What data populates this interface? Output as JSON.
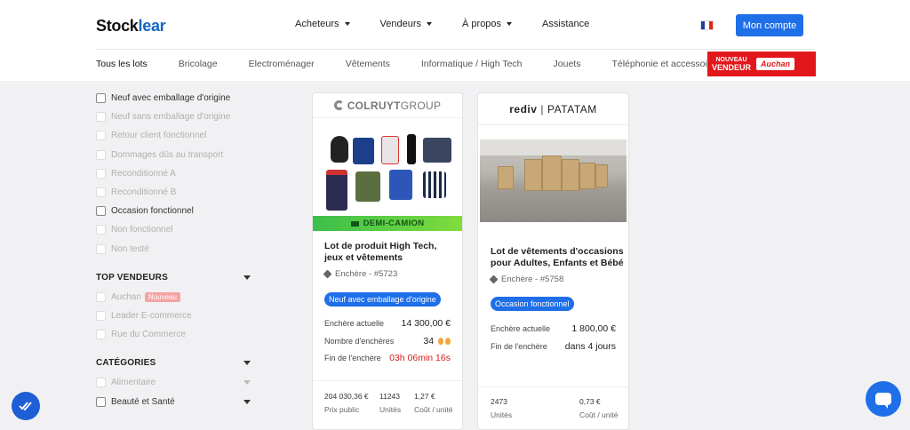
{
  "header": {
    "logo_main": "Stock",
    "logo_accent": "lear",
    "nav": [
      {
        "label": "Acheteurs",
        "has_caret": true
      },
      {
        "label": "Vendeurs",
        "has_caret": true
      },
      {
        "label": "À propos",
        "has_caret": true
      },
      {
        "label": "Assistance",
        "has_caret": false
      }
    ],
    "account_button": "Mon compte",
    "flag_colors": [
      "#1f3ca6",
      "#ffffff",
      "#e1251b"
    ]
  },
  "categories_nav": [
    "Tous les lots",
    "Bricolage",
    "Electroménager",
    "Vêtements",
    "Informatique / High Tech",
    "Jouets",
    "Téléphonie et accessoires"
  ],
  "promo_banner": {
    "line1": "NOUVEAU",
    "line2": "VENDEUR",
    "brand": "Auchan"
  },
  "filters": {
    "conditions": [
      {
        "label": "Neuf avec emballage d'origine",
        "enabled": true
      },
      {
        "label": "Neuf sans emballage d'origine",
        "enabled": false
      },
      {
        "label": "Retour client fonctionnel",
        "enabled": false
      },
      {
        "label": "Dommages dûs au transport",
        "enabled": false
      },
      {
        "label": "Reconditionné A",
        "enabled": false
      },
      {
        "label": "Reconditionné B",
        "enabled": false
      },
      {
        "label": "Occasion fonctionnel",
        "enabled": true
      },
      {
        "label": "Non fonctionnel",
        "enabled": false
      },
      {
        "label": "Non testé",
        "enabled": false
      }
    ],
    "top_vendors_title": "TOP VENDEURS",
    "vendors": [
      {
        "label": "Auchan",
        "badge": "Nouveau"
      },
      {
        "label": "Leader E-commerce"
      },
      {
        "label": "Rue du Commerce"
      }
    ],
    "categories_title": "CATÉGORIES",
    "categories": [
      {
        "label": "Alimentaire",
        "enabled": false
      },
      {
        "label": "Beauté et Santé",
        "enabled": true
      }
    ]
  },
  "lots": [
    {
      "vendor_bold": "COLRUYT",
      "vendor_light": "GROUP",
      "band": "DEMI-CAMION",
      "title": "Lot de produit High Tech, jeux et vêtements",
      "ref": "Enchère - #5723",
      "condition": "Neuf avec emballage d'origine",
      "current_bid_label": "Enchère actuelle",
      "current_bid": "14 300,00 €",
      "bids_label": "Nombre d'enchères",
      "bids": "34",
      "end_label": "Fin de l'enchère",
      "end": "03h 06min 16s",
      "footer": [
        {
          "value": "204 030,36 €",
          "label": "Prix public"
        },
        {
          "value": "11243",
          "label": "Unités"
        },
        {
          "value": "1,27 €",
          "label": "Coût / unité"
        }
      ]
    },
    {
      "vendor_bold": "rediv",
      "vendor_light": "PATATAM",
      "title": "Lot de vêtements d'occasions pour Adultes, Enfants et Bébé",
      "ref": "Enchère - #5758",
      "condition": "Occasion fonctionnel",
      "current_bid_label": "Enchère actuelle",
      "current_bid": "1 800,00 €",
      "end_label": "Fin de l'enchère",
      "end": "dans 4 jours",
      "footer": [
        {
          "value": "2473",
          "label": "Unités"
        },
        {
          "value": "0,73 €",
          "label": "Coût / unité"
        }
      ]
    }
  ],
  "colors": {
    "accent": "#1e6fe8",
    "band_green": "#5fd03f",
    "timer_red": "#d32020"
  }
}
